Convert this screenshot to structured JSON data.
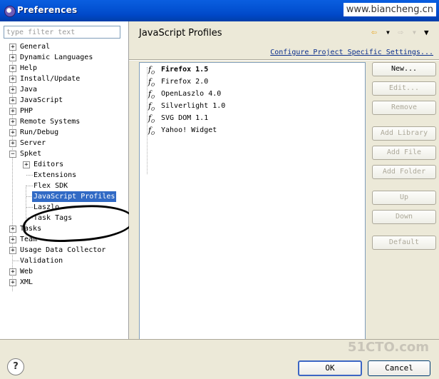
{
  "window": {
    "title": "Preferences",
    "watermark": "www.biancheng.cn"
  },
  "filter": {
    "placeholder": "type filter text"
  },
  "tree": {
    "items": [
      {
        "label": "General"
      },
      {
        "label": "Dynamic Languages"
      },
      {
        "label": "Help"
      },
      {
        "label": "Install/Update"
      },
      {
        "label": "Java"
      },
      {
        "label": "JavaScript"
      },
      {
        "label": "PHP"
      },
      {
        "label": "Remote Systems"
      },
      {
        "label": "Run/Debug"
      },
      {
        "label": "Server"
      },
      {
        "label": "Spket"
      },
      {
        "label": "Editors"
      },
      {
        "label": "Extensions"
      },
      {
        "label": "Flex SDK"
      },
      {
        "label": "JavaScript Profiles"
      },
      {
        "label": "Laszlo"
      },
      {
        "label": "Task Tags"
      },
      {
        "label": "Tasks"
      },
      {
        "label": "Team"
      },
      {
        "label": "Usage Data Collector"
      },
      {
        "label": "Validation"
      },
      {
        "label": "Web"
      },
      {
        "label": "XML"
      }
    ]
  },
  "page": {
    "title": "JavaScript Profiles",
    "configure_link": "Configure Project Specific Settings...",
    "profiles": [
      {
        "label": "Firefox 1.5"
      },
      {
        "label": "Firefox 2.0"
      },
      {
        "label": "OpenLaszlo 4.0"
      },
      {
        "label": "Silverlight 1.0"
      },
      {
        "label": "SVG DOM 1.1"
      },
      {
        "label": "Yahoo! Widget"
      }
    ],
    "buttons": {
      "new": "New...",
      "edit": "Edit...",
      "remove": "Remove",
      "add_library": "Add Library",
      "add_file": "Add File",
      "add_folder": "Add Folder",
      "up": "Up",
      "down": "Down",
      "default": "Default"
    }
  },
  "footer": {
    "help": "?",
    "ok": "OK",
    "cancel": "Cancel",
    "watermark": "51CTO.com"
  }
}
